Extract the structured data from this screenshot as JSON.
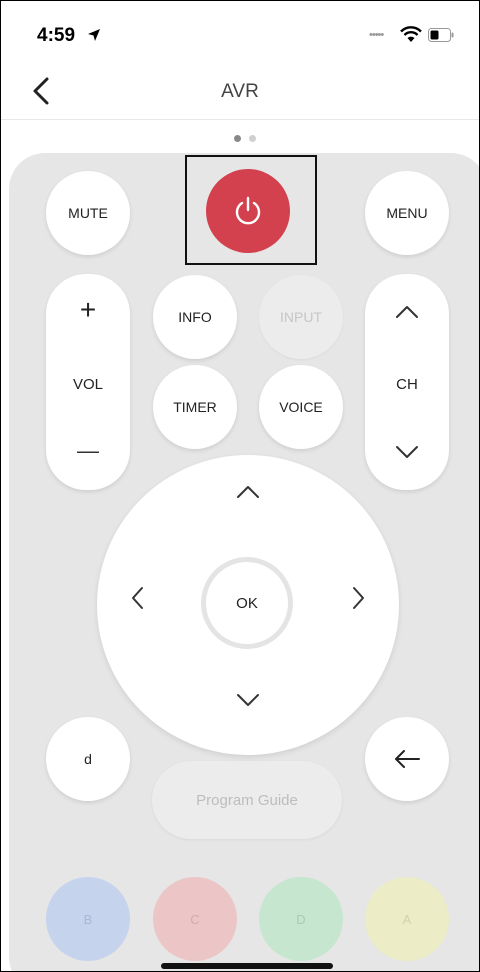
{
  "status_bar": {
    "time": "4:59"
  },
  "nav": {
    "title": "AVR"
  },
  "remote": {
    "mute": "MUTE",
    "menu": "MENU",
    "vol_label": "VOL",
    "vol_plus": "+",
    "vol_minus": "—",
    "ch_label": "CH",
    "info": "INFO",
    "input": "INPUT",
    "timer": "TIMER",
    "voice": "VOICE",
    "ok": "OK",
    "d": "d",
    "program_guide": "Program Guide",
    "colors": [
      {
        "label": "B",
        "bg": "#c6d3ec",
        "fg": "#a9b8d6"
      },
      {
        "label": "C",
        "bg": "#ecc6c6",
        "fg": "#d6a9a9"
      },
      {
        "label": "D",
        "bg": "#c6e6cf",
        "fg": "#a9ccb4"
      },
      {
        "label": "A",
        "bg": "#ececc6",
        "fg": "#d3d3a9"
      }
    ]
  },
  "theme": {
    "power_color": "#d3404e",
    "panel_bg": "#e6e6e6"
  },
  "pager": {
    "count": 2,
    "active": 1
  }
}
